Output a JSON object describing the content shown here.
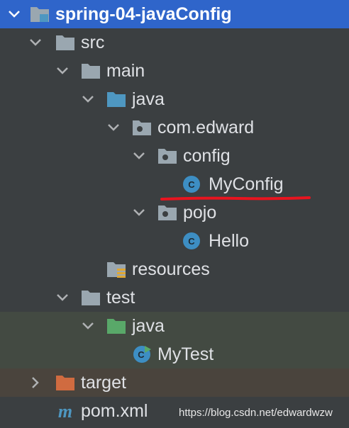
{
  "project": {
    "label": "spring-04-javaConfig"
  },
  "tree": {
    "src": "src",
    "main": "main",
    "main_java": "java",
    "package": "com.edward",
    "config": "config",
    "myconfig": "MyConfig",
    "pojo": "pojo",
    "hello": "Hello",
    "resources": "resources",
    "test": "test",
    "test_java": "java",
    "mytest": "MyTest",
    "target": "target",
    "pom": "pom.xml"
  },
  "watermark": "https://blog.csdn.net/edwardwzw",
  "colors": {
    "background": "#3b3f41",
    "selection": "#2f65ca",
    "test_row": "#434a42",
    "excluded_row": "#4a443d",
    "folder": "#9aa7b0",
    "source_folder": "#4e97c1",
    "test_folder": "#59a869",
    "excluded_folder": "#d06b40",
    "class_icon": "#3d8ec3",
    "annotation": "#e8141f"
  },
  "icons": [
    "module-folder-icon",
    "folder-icon",
    "source-folder-icon",
    "package-icon",
    "class-icon",
    "resources-folder-icon",
    "test-folder-icon",
    "test-class-icon",
    "excluded-folder-icon",
    "maven-icon",
    "chevron-down-icon",
    "chevron-right-icon"
  ]
}
